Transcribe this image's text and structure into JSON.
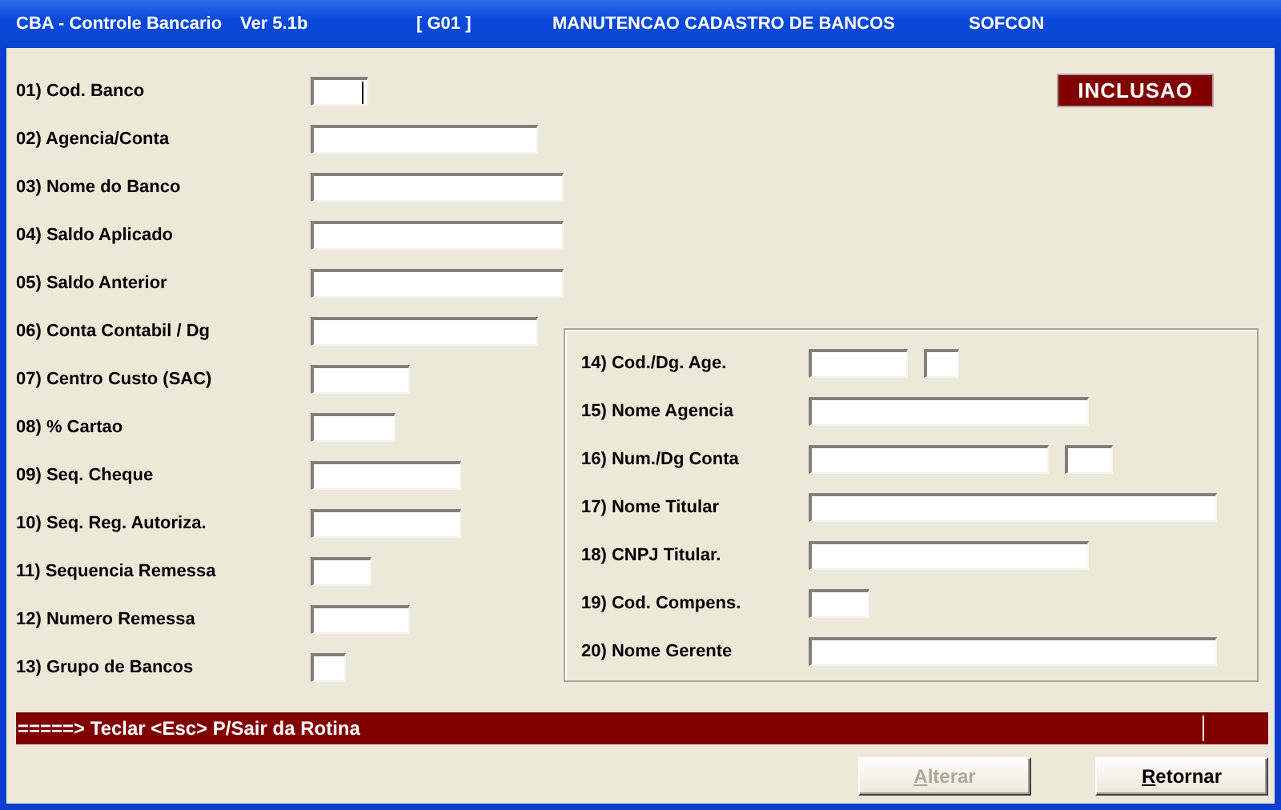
{
  "window": {
    "title_parts": [
      "CBA - Controle Bancario",
      "Ver 5.1b",
      "[ G01 ]",
      "MANUTENCAO CADASTRO DE BANCOS",
      "SOFCON"
    ]
  },
  "mode_badge": "INCLUSAO",
  "left_fields": [
    {
      "label": "01) Cod. Banco",
      "focused": true
    },
    {
      "label": "02) Agencia/Conta",
      "focused": false
    },
    {
      "label": "03) Nome do Banco",
      "focused": false
    },
    {
      "label": "04) Saldo Aplicado",
      "focused": false
    },
    {
      "label": "05) Saldo Anterior",
      "focused": false
    },
    {
      "label": "06) Conta Contabil / Dg",
      "focused": false
    },
    {
      "label": "07) Centro Custo (SAC)",
      "focused": false
    },
    {
      "label": "08) % Cartao",
      "focused": false
    },
    {
      "label": "09) Seq. Cheque",
      "focused": false
    },
    {
      "label": "10) Seq. Reg. Autoriza.",
      "focused": false
    },
    {
      "label": "11) Sequencia Remessa",
      "focused": false
    },
    {
      "label": "12) Numero Remessa",
      "focused": false
    },
    {
      "label": "13) Grupo de Bancos",
      "focused": false
    }
  ],
  "right_fields": [
    {
      "label": "14) Cod./Dg. Age.",
      "digit_field": true
    },
    {
      "label": "15) Nome Agencia",
      "digit_field": false
    },
    {
      "label": "16) Num./Dg Conta",
      "digit_field": true
    },
    {
      "label": "17) Nome Titular",
      "digit_field": false
    },
    {
      "label": "18) CNPJ Titular.",
      "digit_field": false
    },
    {
      "label": "19) Cod. Compens.",
      "digit_field": false
    },
    {
      "label": "20) Nome Gerente",
      "digit_field": false
    }
  ],
  "status_bar": "=====> Teclar <Esc> P/Sair da Rotina",
  "buttons": [
    {
      "label": "Alterar",
      "disabled": true
    },
    {
      "label": "Retornar",
      "disabled": false
    }
  ]
}
